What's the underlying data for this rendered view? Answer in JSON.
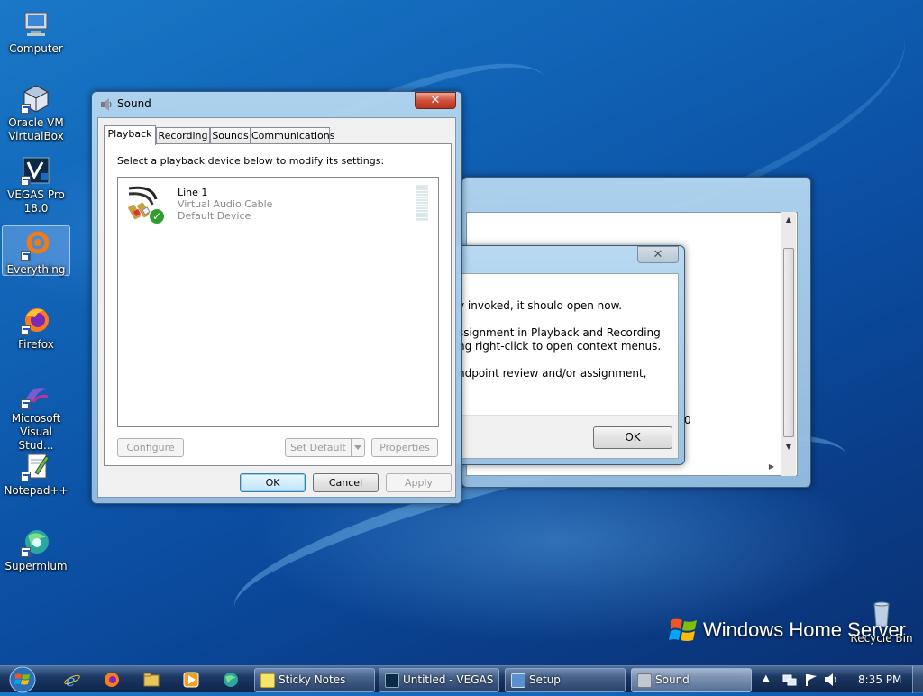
{
  "desktop": {
    "icons": [
      {
        "label": "Computer"
      },
      {
        "label": "Oracle VM\nVirtualBox"
      },
      {
        "label": "VEGAS Pro\n18.0"
      },
      {
        "label": "Everything"
      },
      {
        "label": "Firefox"
      },
      {
        "label": "Microsoft\nVisual Stud..."
      },
      {
        "label": "Notepad++"
      },
      {
        "label": "Supermium"
      }
    ],
    "recycle_bin_label": "Recycle Bin",
    "branding": "Windows Home Server"
  },
  "back_dialog": {
    "lines": [
      "y invoked, it should open now.",
      "ssignment in Playback and Recording",
      "ng right-click to open context menus.",
      "ndpoint review and/or assignment,"
    ],
    "ok_label": "OK",
    "side_char": "0"
  },
  "sound_dialog": {
    "title": "Sound",
    "close_glyph": "✕",
    "tabs": [
      "Playback",
      "Recording",
      "Sounds",
      "Communications"
    ],
    "active_tab": "Playback",
    "instruction": "Select a playback device below to modify its settings:",
    "devices": [
      {
        "name": "Line 1",
        "description": "Virtual Audio Cable",
        "status": "Default Device"
      }
    ],
    "buttons": {
      "configure": "Configure",
      "set_default": "Set Default",
      "properties": "Properties",
      "ok": "OK",
      "cancel": "Cancel",
      "apply": "Apply"
    }
  },
  "taskbar": {
    "windows": [
      {
        "label": "Sticky Notes"
      },
      {
        "label": "Untitled - VEGAS ..."
      },
      {
        "label": "Setup"
      },
      {
        "label": "Sound"
      }
    ],
    "clock": "8:35 PM"
  },
  "colors": {
    "accent": "#3c7fb1",
    "check_green": "#2f9e2f",
    "close_red": "#c8432c"
  }
}
